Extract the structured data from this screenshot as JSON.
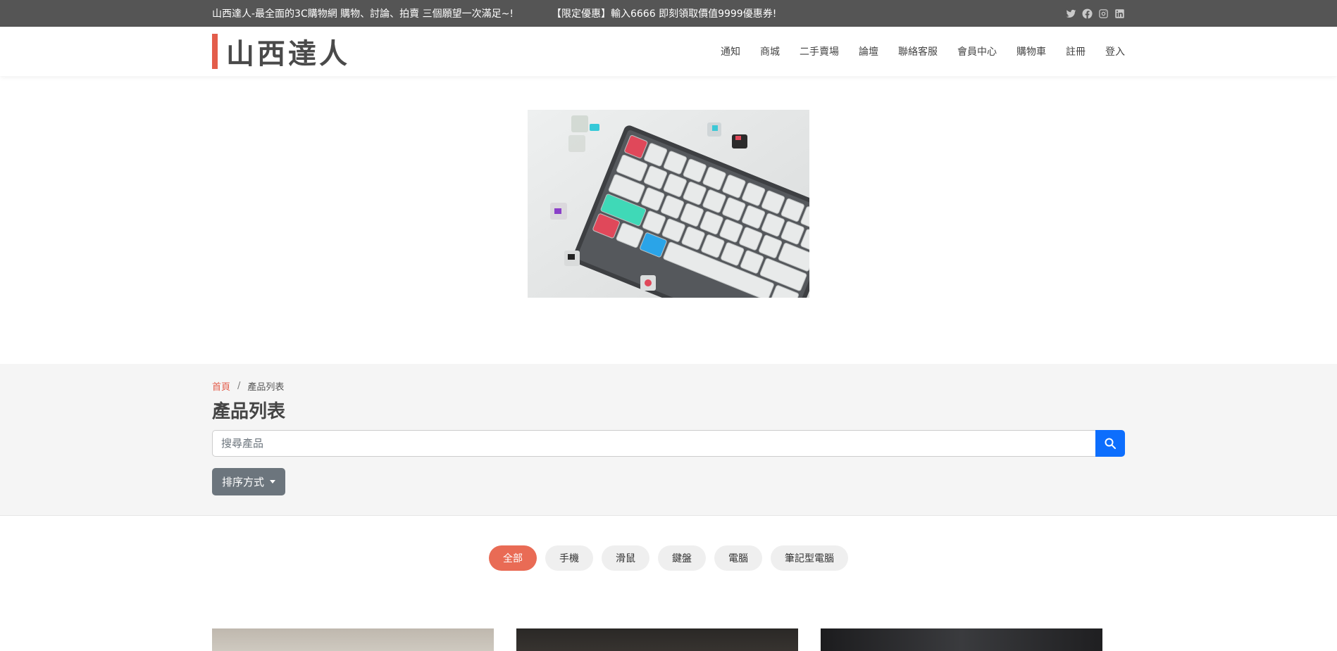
{
  "topbar": {
    "slogan": "山西達人-最全面的3C購物網 購物、討論、拍賣 三個願望一次滿足~!",
    "promo": "【限定優惠】輸入6666 即刻領取價值9999優惠券!",
    "social_icons": [
      "twitter-icon",
      "facebook-icon",
      "instagram-icon",
      "linkedin-icon"
    ]
  },
  "header": {
    "logo_text": "山西達人",
    "nav": [
      "通知",
      "商城",
      "二手賣場",
      "論壇",
      "聯絡客服",
      "會員中心",
      "購物車",
      "註冊",
      "登入"
    ]
  },
  "breadcrumb": {
    "home": "首頁",
    "separator": "/",
    "current": "產品列表"
  },
  "page_title": "產品列表",
  "search": {
    "placeholder": "搜尋產品",
    "value": ""
  },
  "sort": {
    "label": "排序方式"
  },
  "filters": {
    "items": [
      "全部",
      "手機",
      "滑鼠",
      "鍵盤",
      "電腦",
      "筆記型電腦"
    ],
    "active": "全部"
  },
  "colors": {
    "topbar_bg": "#555555",
    "accent": "#e35d4b",
    "search_button": "#0d6efd",
    "sort_button": "#6c757d"
  }
}
